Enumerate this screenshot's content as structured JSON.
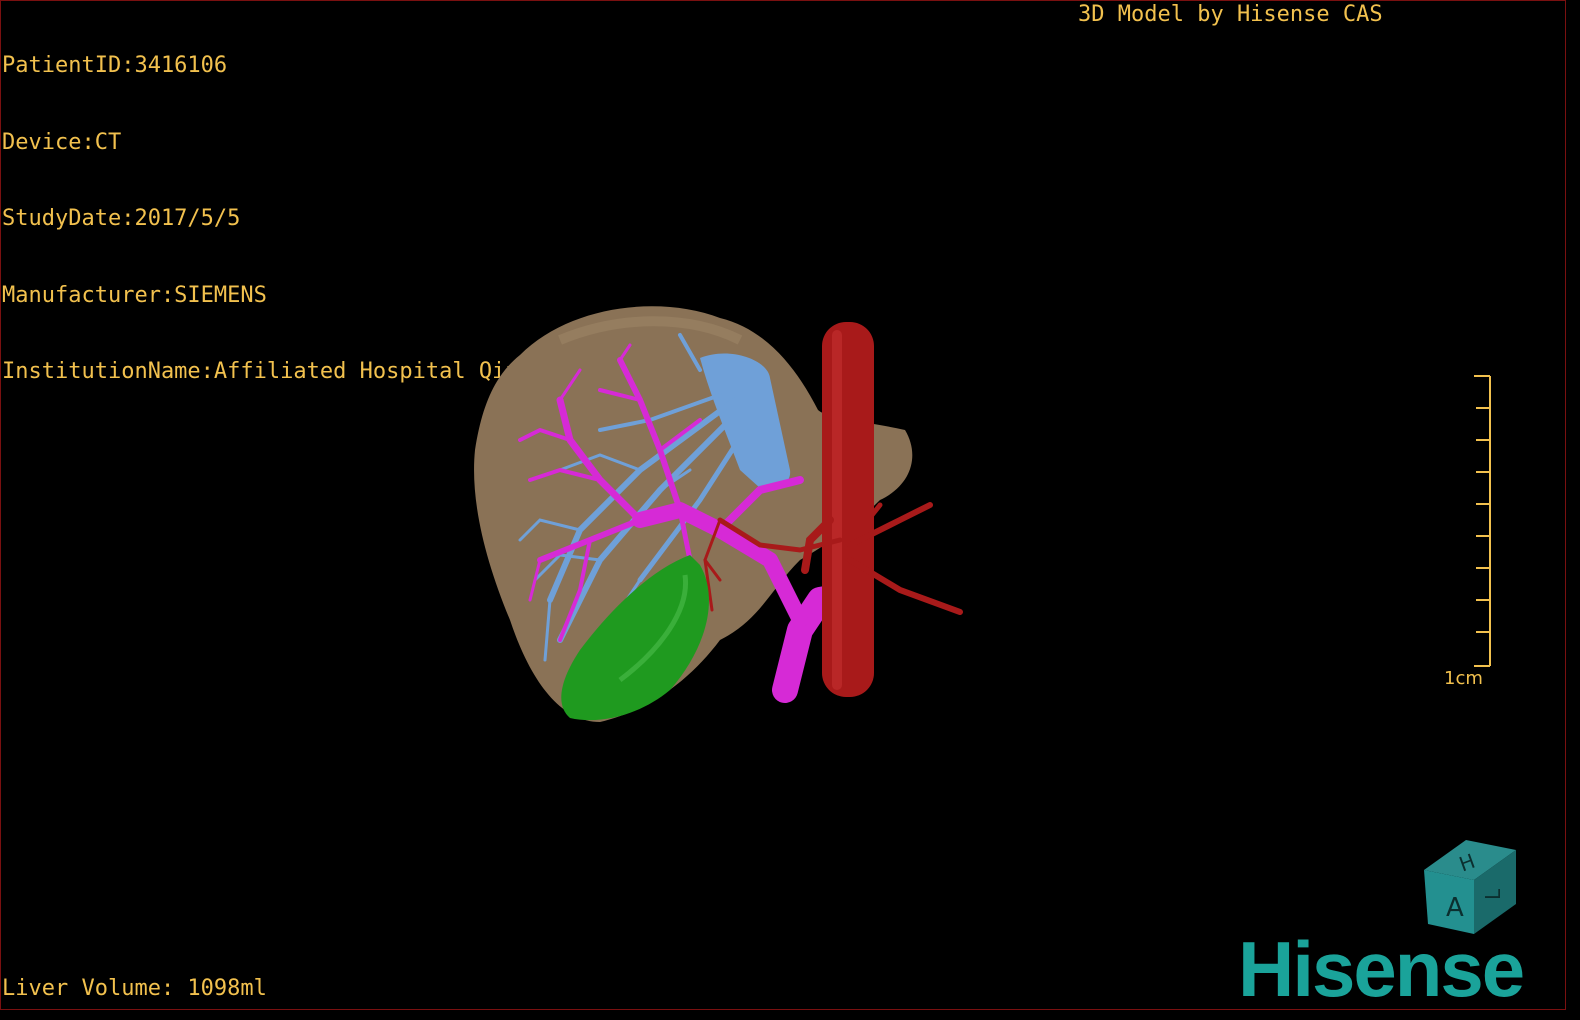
{
  "overlay": {
    "patient_id": "PatientID:3416106",
    "device": "Device:CT",
    "study_date": "StudyDate:2017/5/5",
    "manufacturer": "Manufacturer:SIEMENS",
    "institution": "InstitutionName:Affiliated Hospital Qingdao University-C",
    "credit": "3D Model by Hisense CAS",
    "liver_volume": "Liver Volume: 1098ml"
  },
  "scale_bar": {
    "label": "1cm"
  },
  "orientation_cube": {
    "face_front": "A",
    "face_top": "H",
    "face_side": "L"
  },
  "brand": {
    "name": "Hisense"
  },
  "colors": {
    "overlay_text": "#f2c14e",
    "liver": "#8a7256",
    "hepatic_vein": "#6fa0d8",
    "portal_vein": "#d62ad6",
    "artery": "#a81a1a",
    "gallbladder": "#1f9a1f",
    "brand": "#1aa39a"
  }
}
